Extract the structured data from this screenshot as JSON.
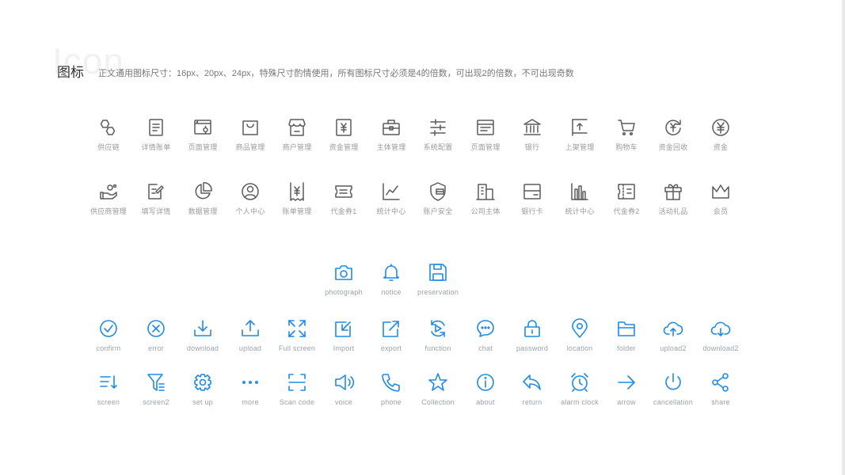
{
  "header": {
    "watermark": "Icon",
    "title": "图标",
    "description": "正文通用图标尺寸：16px、20px、24px，特殊尺寸酌情使用，所有图标尺寸必须是4的倍数，可出现2的倍数，不可出现奇数"
  },
  "colors": {
    "gray_icon": "#5b5b5b",
    "blue_icon": "#1e8be6",
    "label": "#9a9a9a"
  },
  "gray_row1": [
    {
      "icon": "supply-chain-icon",
      "label": "供应链"
    },
    {
      "icon": "bill-detail-icon",
      "label": "详情账单"
    },
    {
      "icon": "page-settings-icon",
      "label": "页面管理"
    },
    {
      "icon": "shopping-bag-icon",
      "label": "商品管理"
    },
    {
      "icon": "store-icon",
      "label": "商户管理"
    },
    {
      "icon": "yen-document-icon",
      "label": "资金管理"
    },
    {
      "icon": "briefcase-icon",
      "label": "主体管理"
    },
    {
      "icon": "sliders-icon",
      "label": "系统配置"
    },
    {
      "icon": "browser-window-icon",
      "label": "页面管理"
    },
    {
      "icon": "bank-icon",
      "label": "银行"
    },
    {
      "icon": "shelf-upload-icon",
      "label": "上架管理"
    },
    {
      "icon": "cart-icon",
      "label": "购物车"
    },
    {
      "icon": "yen-refresh-icon",
      "label": "资金回收"
    },
    {
      "icon": "yen-circle-icon",
      "label": "资金"
    }
  ],
  "gray_row2": [
    {
      "icon": "hand-coin-icon",
      "label": "供应商管理"
    },
    {
      "icon": "edit-form-icon",
      "label": "填写详情"
    },
    {
      "icon": "pie-chart-icon",
      "label": "数据管理"
    },
    {
      "icon": "user-circle-icon",
      "label": "个人中心"
    },
    {
      "icon": "yen-receipt-icon",
      "label": "账单管理"
    },
    {
      "icon": "coupon-icon",
      "label": "代金券1"
    },
    {
      "icon": "line-chart-icon",
      "label": "统计中心"
    },
    {
      "icon": "shield-card-icon",
      "label": "账户安全"
    },
    {
      "icon": "building-icon",
      "label": "公司主体"
    },
    {
      "icon": "bank-card-icon",
      "label": "银行卡"
    },
    {
      "icon": "bar-chart-icon",
      "label": "统计中心"
    },
    {
      "icon": "ticket-icon",
      "label": "代金券2"
    },
    {
      "icon": "gift-icon",
      "label": "活动礼品"
    },
    {
      "icon": "crown-icon",
      "label": "会员"
    }
  ],
  "blue_row0": [
    {
      "icon": "camera-icon",
      "label": "photograph"
    },
    {
      "icon": "bell-icon",
      "label": "notice"
    },
    {
      "icon": "floppy-icon",
      "label": "preservation"
    }
  ],
  "blue_row1": [
    {
      "icon": "check-circle-icon",
      "label": "confirm"
    },
    {
      "icon": "x-circle-icon",
      "label": "error"
    },
    {
      "icon": "download-icon",
      "label": "download"
    },
    {
      "icon": "upload-icon",
      "label": "upload"
    },
    {
      "icon": "fullscreen-icon",
      "label": "Full screen"
    },
    {
      "icon": "import-icon",
      "label": "Import"
    },
    {
      "icon": "export-icon",
      "label": "export"
    },
    {
      "icon": "function-icon",
      "label": "function"
    },
    {
      "icon": "chat-icon",
      "label": "chat"
    },
    {
      "icon": "lock-icon",
      "label": "password"
    },
    {
      "icon": "location-pin-icon",
      "label": "location"
    },
    {
      "icon": "folder-icon",
      "label": "folder"
    },
    {
      "icon": "cloud-upload-icon",
      "label": "upload2"
    },
    {
      "icon": "cloud-download-icon",
      "label": "download2"
    }
  ],
  "blue_row2": [
    {
      "icon": "sort-list-icon",
      "label": "screen"
    },
    {
      "icon": "filter-icon",
      "label": "screen2"
    },
    {
      "icon": "gear-icon",
      "label": "set up"
    },
    {
      "icon": "more-dots-icon",
      "label": "more"
    },
    {
      "icon": "scan-icon",
      "label": "Scan code"
    },
    {
      "icon": "speaker-icon",
      "label": "voice"
    },
    {
      "icon": "phone-icon",
      "label": "phone"
    },
    {
      "icon": "star-icon",
      "label": "Collection"
    },
    {
      "icon": "info-circle-icon",
      "label": "about"
    },
    {
      "icon": "reply-icon",
      "label": "return"
    },
    {
      "icon": "alarm-clock-icon",
      "label": "alarm clock"
    },
    {
      "icon": "arrow-right-icon",
      "label": "arrow"
    },
    {
      "icon": "power-icon",
      "label": "cancellation"
    },
    {
      "icon": "share-icon",
      "label": "share"
    }
  ]
}
